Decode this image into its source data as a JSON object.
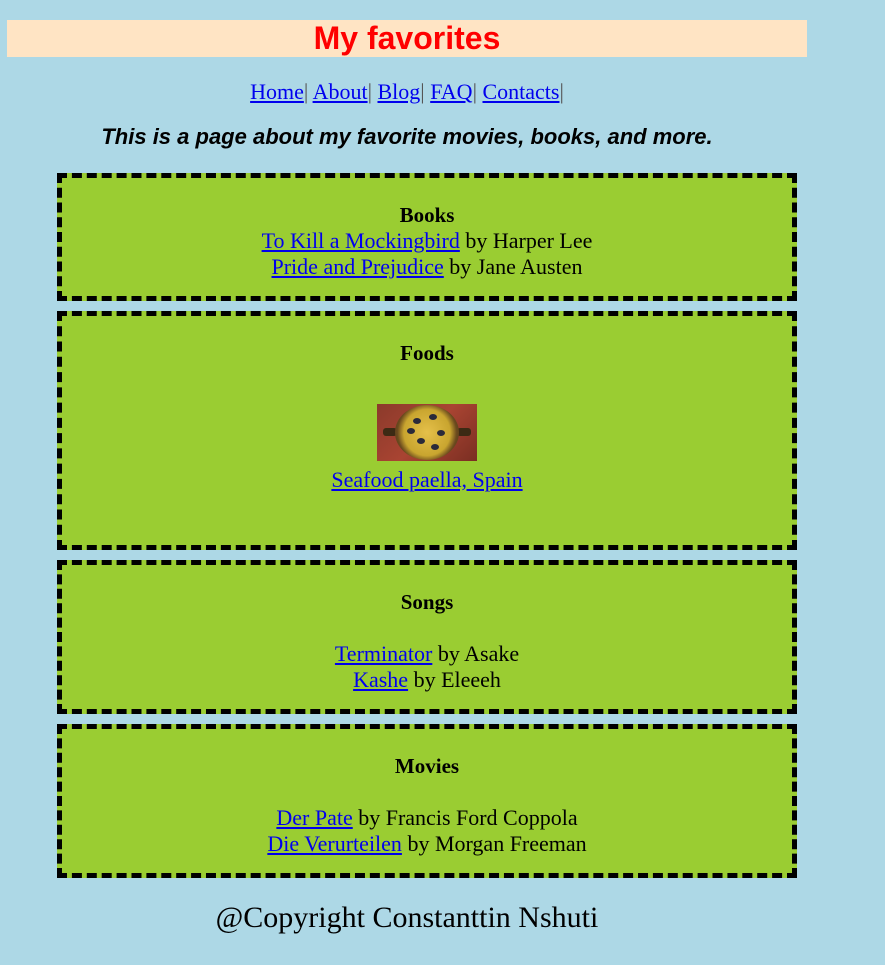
{
  "header": {
    "title": "My favorites"
  },
  "nav": {
    "items": [
      {
        "label": "Home",
        "sep": "|"
      },
      {
        "label": "About",
        "sep": "|"
      },
      {
        "label": "Blog",
        "sep": "|"
      },
      {
        "label": "FAQ",
        "sep": "|"
      },
      {
        "label": "Contacts",
        "sep": "|"
      }
    ]
  },
  "tagline": "This is a page about my favorite movies, books, and more.",
  "books": {
    "heading": "Books",
    "items": [
      {
        "title": "To Kill a Mockingbird",
        "by": " by Harper Lee"
      },
      {
        "title": "Pride and Prejudice",
        "by": " by Jane Austen"
      }
    ]
  },
  "foods": {
    "heading": "Foods",
    "image_icon": "paella-dish-image",
    "item": {
      "title": "Seafood paella, Spain"
    }
  },
  "songs": {
    "heading": "Songs",
    "items": [
      {
        "title": "Terminator",
        "by": " by Asake"
      },
      {
        "title": "Kashe",
        "by": " by Eleeeh"
      }
    ]
  },
  "movies": {
    "heading": "Movies",
    "items": [
      {
        "title": "Der Pate",
        "by": " by Francis Ford Coppola"
      },
      {
        "title": "Die Verurteilen",
        "by": " by Morgan Freeman"
      }
    ]
  },
  "footer": {
    "text": "@Copyright Constanttin Nshuti"
  },
  "colors": {
    "background": "#add8e6",
    "title_bar": "#ffe4c4",
    "title_text": "#ff0000",
    "box_fill": "#9acd32",
    "link": "#0000ee"
  }
}
